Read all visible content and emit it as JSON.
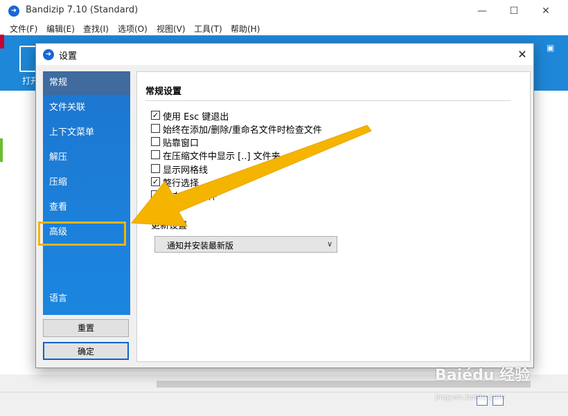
{
  "app": {
    "title": "Bandizip 7.10 (Standard)",
    "logo_glyph": "➜",
    "window_controls": {
      "minimize": "—",
      "maximize": "☐",
      "close": "✕"
    }
  },
  "menu": {
    "items": [
      "文件(F)",
      "编辑(E)",
      "查找(I)",
      "选项(O)",
      "视图(V)",
      "工具(T)",
      "帮助(H)"
    ]
  },
  "ribbon": {
    "open_label": "打开",
    "grid_icon": "▣"
  },
  "dialog": {
    "title": "设置",
    "close": "✕",
    "nav": {
      "items": [
        "常规",
        "文件关联",
        "上下文菜单",
        "解压",
        "压缩",
        "查看",
        "高级",
        "语言"
      ],
      "active": "常规",
      "highlighted": "高级"
    },
    "buttons": {
      "reset": "重置",
      "ok": "确定"
    },
    "general": {
      "section_title": "常规设置",
      "checkboxes": [
        {
          "label": "使用 Esc 键退出",
          "checked": true
        },
        {
          "label": "始终在添加/删除/重命名文件时检查文件",
          "checked": false
        },
        {
          "label": "贴靠窗口",
          "checked": false
        },
        {
          "label": "在压缩文件中显示 [..] 文件夹",
          "checked": false
        },
        {
          "label": "显示网格线",
          "checked": false
        },
        {
          "label": "整行选择",
          "checked": true
        },
        {
          "label": "单击打开文件",
          "checked": true
        }
      ],
      "update_label": "更新设置",
      "update_select": {
        "value": "通知并安装最新版",
        "chevron": "∨"
      }
    }
  },
  "check_mark": "✓",
  "watermark": {
    "brand": "Baiédu 经验",
    "url": "jingyan.baidu.com"
  },
  "colors": {
    "accent": "#1e87d8",
    "highlight": "#f4b400",
    "nav_active": "#3f6b9f"
  }
}
